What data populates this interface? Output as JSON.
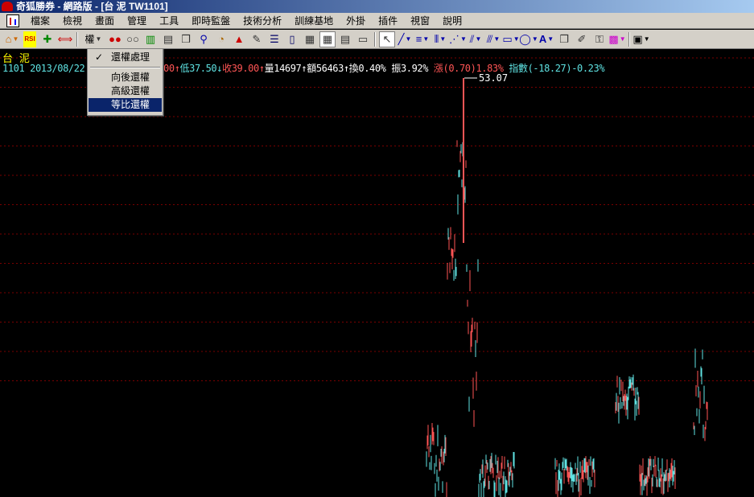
{
  "window": {
    "title": "奇狐勝券 - 網路版 - [台 泥 TW1101]"
  },
  "menu": {
    "items": [
      "檔案",
      "檢視",
      "畫面",
      "管理",
      "工具",
      "即時監盤",
      "技術分析",
      "訓練基地",
      "外掛",
      "插件",
      "視窗",
      "說明"
    ]
  },
  "toolbar": {
    "adjust_label": "權",
    "rsi_label": "RSI",
    "font_label": "A"
  },
  "dropdown": {
    "items": [
      {
        "label": "還權處理",
        "checked": true
      },
      {
        "label": "向後還權",
        "checked": false
      },
      {
        "label": "高級還權",
        "checked": false
      },
      {
        "label": "等比還權",
        "checked": false,
        "selected": true
      }
    ]
  },
  "stock": {
    "name": "台 泥",
    "code": "1101",
    "date": "2013/08/22",
    "open_partial": "0.00",
    "low": "低37.50",
    "close": "收39.00",
    "volume": "量14697",
    "amount": "額56463",
    "turnover": "換0.40%",
    "amplitude": "振3.92%",
    "change": "漲(0.70)1.83%",
    "index": "指數(-18.27)-0.23%"
  },
  "chart_data": {
    "type": "line",
    "peak_label": "53.07",
    "colors": {
      "up": "#ff5555",
      "down": "#5fe3e3",
      "grid": "#7a0000"
    }
  },
  "colors": {
    "background": "#000000",
    "price_up": "#ff5555",
    "price_down": "#5fe3e3",
    "name": "#ffff00"
  }
}
